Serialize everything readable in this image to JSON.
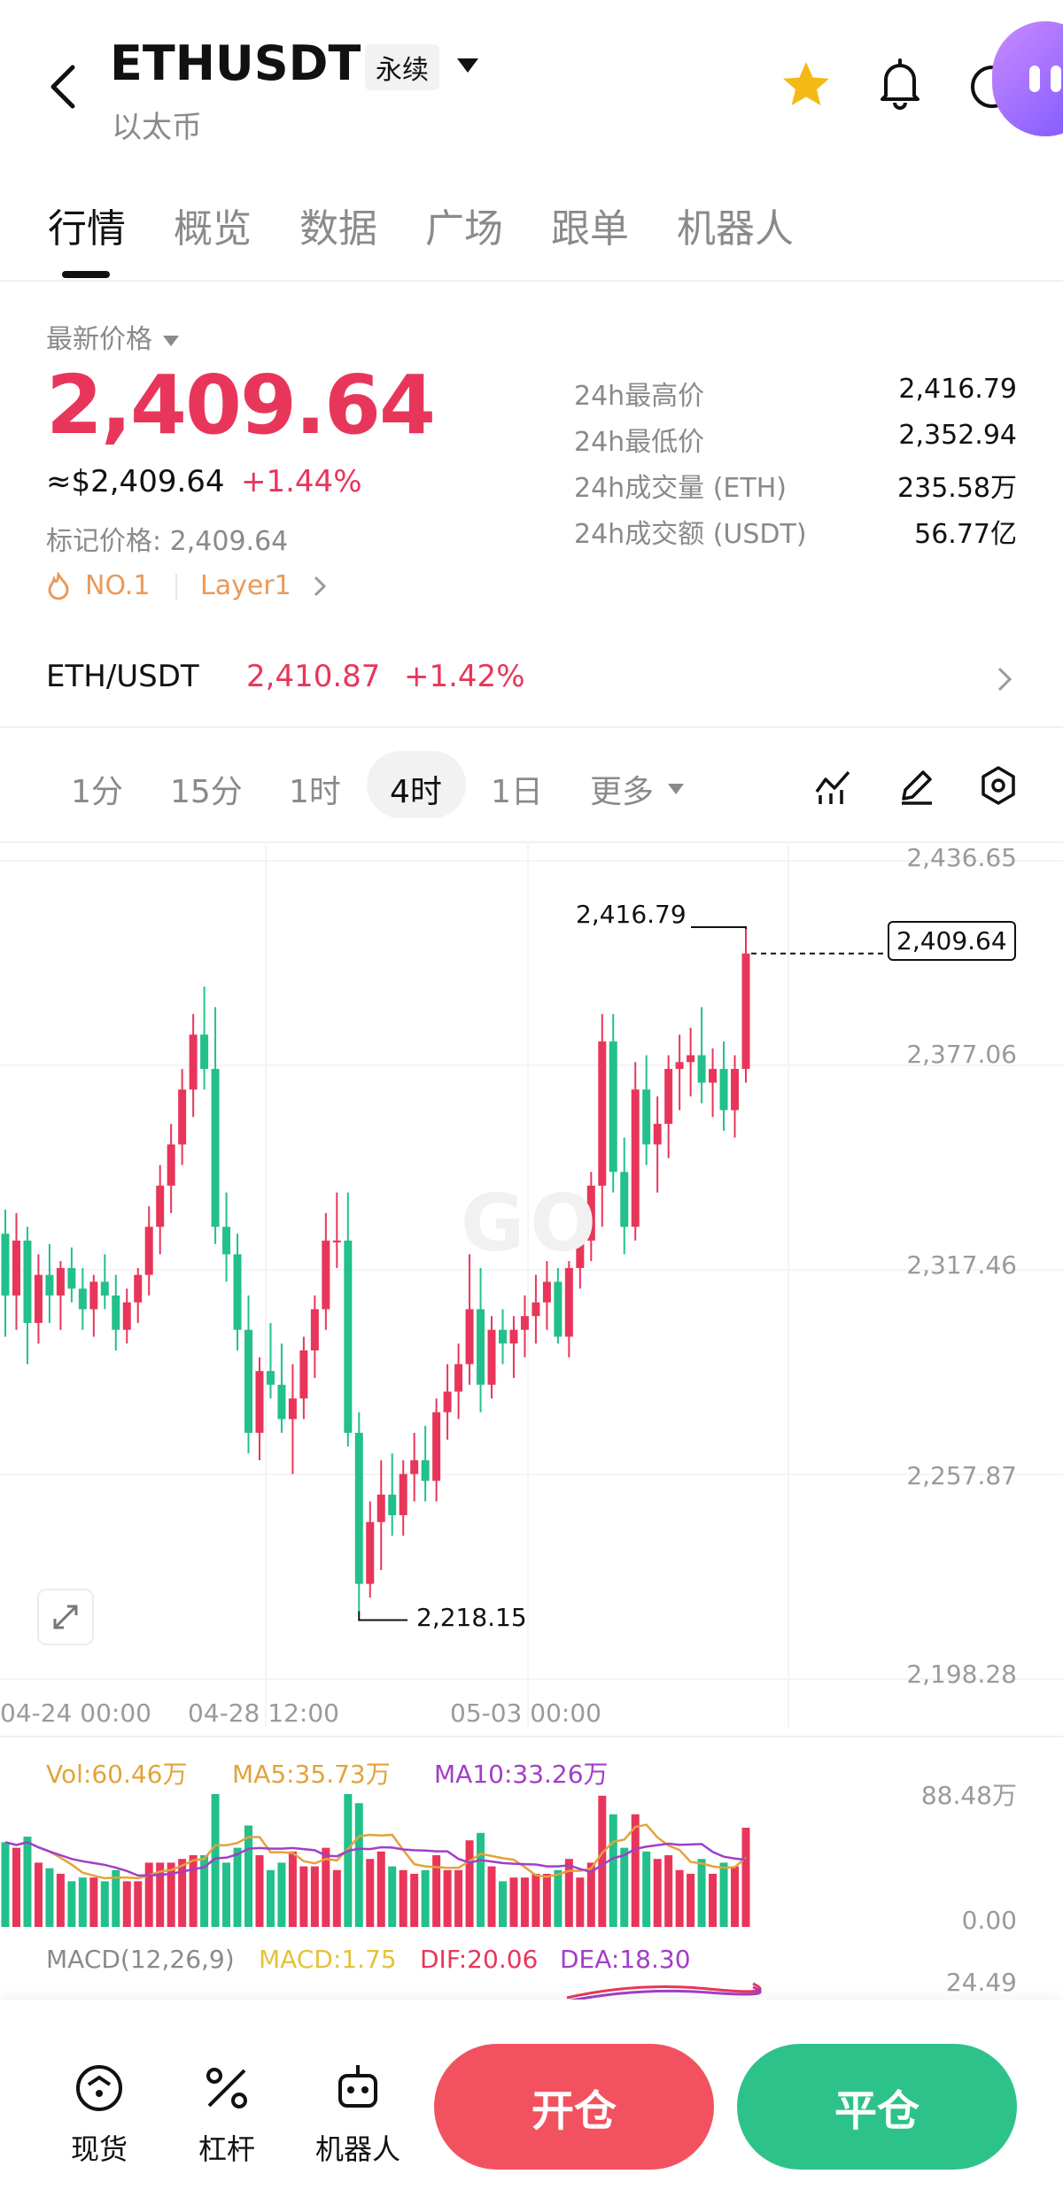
{
  "header": {
    "symbol": "ETHUSDT",
    "contract_badge": "永续",
    "subtitle": "以太币"
  },
  "tabs": [
    {
      "label": "行情",
      "active": true
    },
    {
      "label": "概览"
    },
    {
      "label": "数据"
    },
    {
      "label": "广场"
    },
    {
      "label": "跟单"
    },
    {
      "label": "机器人"
    }
  ],
  "price": {
    "label": "最新价格",
    "value": "2,409.64",
    "usd": "≈$2,409.64",
    "change": "+1.44%",
    "mark_label": "标记价格:",
    "mark_value": "2,409.64",
    "tag_rank": "NO.1",
    "tag_category": "Layer1"
  },
  "stats": [
    {
      "label": "24h最高价",
      "value": "2,416.79"
    },
    {
      "label": "24h最低价",
      "value": "2,352.94"
    },
    {
      "label": "24h成交量 (ETH)",
      "value": "235.58万"
    },
    {
      "label": "24h成交额 (USDT)",
      "value": "56.77亿"
    }
  ],
  "spot": {
    "pair": "ETH/USDT",
    "price": "2,410.87",
    "change": "+1.42%"
  },
  "intervals": [
    {
      "label": "1分"
    },
    {
      "label": "15分"
    },
    {
      "label": "1时"
    },
    {
      "label": "4时",
      "active": true
    },
    {
      "label": "1日"
    },
    {
      "label": "更多"
    }
  ],
  "chart_data": {
    "type": "candlestick",
    "y_ticks": [
      "2,436.65",
      "2,377.06",
      "2,317.46",
      "2,257.87",
      "2,198.28"
    ],
    "x_ticks": [
      "04-24 00:00",
      "04-28 12:00",
      "05-03 00:00"
    ],
    "current_price_label": "2,409.64",
    "high_label": "2,416.79",
    "low_label": "2,218.15",
    "watermark": "GO",
    "candles": [
      [
        2328,
        2335,
        2298,
        2310
      ],
      [
        2310,
        2334,
        2300,
        2326
      ],
      [
        2326,
        2330,
        2290,
        2302
      ],
      [
        2302,
        2322,
        2296,
        2316
      ],
      [
        2316,
        2325,
        2302,
        2310
      ],
      [
        2310,
        2320,
        2300,
        2318
      ],
      [
        2318,
        2324,
        2308,
        2312
      ],
      [
        2312,
        2318,
        2300,
        2306
      ],
      [
        2306,
        2316,
        2298,
        2314
      ],
      [
        2314,
        2322,
        2306,
        2310
      ],
      [
        2310,
        2316,
        2294,
        2300
      ],
      [
        2300,
        2312,
        2296,
        2308
      ],
      [
        2308,
        2318,
        2302,
        2316
      ],
      [
        2316,
        2336,
        2310,
        2330
      ],
      [
        2330,
        2348,
        2322,
        2342
      ],
      [
        2342,
        2360,
        2334,
        2354
      ],
      [
        2354,
        2376,
        2348,
        2370
      ],
      [
        2370,
        2392,
        2362,
        2386
      ],
      [
        2386,
        2400,
        2370,
        2376
      ],
      [
        2376,
        2394,
        2325,
        2330
      ],
      [
        2330,
        2340,
        2314,
        2322
      ],
      [
        2322,
        2328,
        2294,
        2300
      ],
      [
        2300,
        2310,
        2264,
        2270
      ],
      [
        2270,
        2292,
        2262,
        2288
      ],
      [
        2288,
        2302,
        2280,
        2284
      ],
      [
        2284,
        2296,
        2270,
        2274
      ],
      [
        2274,
        2290,
        2258,
        2280
      ],
      [
        2280,
        2298,
        2274,
        2294
      ],
      [
        2294,
        2310,
        2286,
        2306
      ],
      [
        2306,
        2334,
        2300,
        2326
      ],
      [
        2326,
        2340,
        2318,
        2326
      ],
      [
        2326,
        2340,
        2266,
        2270
      ],
      [
        2270,
        2276,
        2218,
        2226
      ],
      [
        2226,
        2250,
        2222,
        2244
      ],
      [
        2244,
        2262,
        2230,
        2252
      ],
      [
        2252,
        2264,
        2240,
        2246
      ],
      [
        2246,
        2262,
        2240,
        2258
      ],
      [
        2258,
        2270,
        2250,
        2262
      ],
      [
        2262,
        2272,
        2250,
        2256
      ],
      [
        2256,
        2280,
        2250,
        2276
      ],
      [
        2276,
        2290,
        2268,
        2282
      ],
      [
        2282,
        2296,
        2274,
        2290
      ],
      [
        2290,
        2322,
        2284,
        2306
      ],
      [
        2306,
        2318,
        2276,
        2284
      ],
      [
        2284,
        2304,
        2280,
        2300
      ],
      [
        2300,
        2306,
        2290,
        2296
      ],
      [
        2296,
        2304,
        2286,
        2300
      ],
      [
        2300,
        2310,
        2292,
        2304
      ],
      [
        2304,
        2316,
        2296,
        2308
      ],
      [
        2308,
        2320,
        2300,
        2314
      ],
      [
        2314,
        2318,
        2296,
        2298
      ],
      [
        2298,
        2320,
        2292,
        2318
      ],
      [
        2318,
        2330,
        2312,
        2326
      ],
      [
        2326,
        2346,
        2320,
        2342
      ],
      [
        2342,
        2392,
        2330,
        2384
      ],
      [
        2384,
        2392,
        2340,
        2346
      ],
      [
        2346,
        2356,
        2322,
        2330
      ],
      [
        2330,
        2378,
        2326,
        2370
      ],
      [
        2370,
        2380,
        2348,
        2354
      ],
      [
        2354,
        2368,
        2340,
        2360
      ],
      [
        2360,
        2380,
        2350,
        2376
      ],
      [
        2376,
        2386,
        2364,
        2378
      ],
      [
        2378,
        2388,
        2368,
        2380
      ],
      [
        2380,
        2394,
        2366,
        2372
      ],
      [
        2372,
        2382,
        2362,
        2376
      ],
      [
        2376,
        2384,
        2358,
        2364
      ],
      [
        2364,
        2380,
        2356,
        2376
      ],
      [
        2376,
        2416.79,
        2372,
        2409.64
      ]
    ],
    "volume_legend": {
      "vol": "Vol:60.46万",
      "ma5": "MA5:35.73万",
      "ma10": "MA10:33.26万"
    },
    "volume_axis": [
      "88.48万",
      "0.00"
    ],
    "macd_legend": {
      "title": "MACD(12,26,9)",
      "macd": "MACD:1.75",
      "dif": "DIF:20.06",
      "dea": "DEA:18.30"
    },
    "macd_axis_top": "24.49",
    "colors": {
      "up": "#e8365a",
      "down": "#22c08a",
      "ma5": "#e3a33a",
      "ma10": "#a23ec8"
    }
  },
  "bottom": {
    "spot_label": "现货",
    "leverage_label": "杠杆",
    "bot_label": "机器人",
    "open_label": "开仓",
    "close_label": "平仓"
  }
}
